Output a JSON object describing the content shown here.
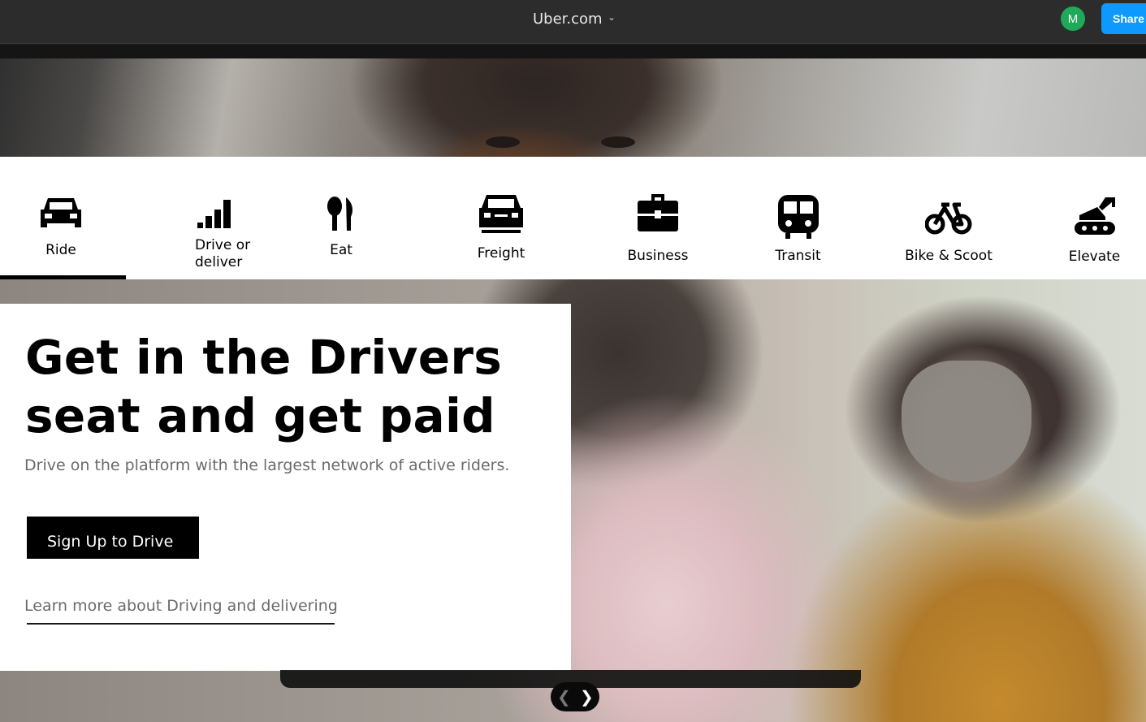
{
  "topbar": {
    "title": "Uber.com",
    "avatar_initial": "M",
    "share_label": "Share"
  },
  "nav": {
    "items": [
      {
        "label": "Ride",
        "icon": "car-icon",
        "selected": true
      },
      {
        "label": "Drive or deliver",
        "line1": "Drive or",
        "line2": "deliver",
        "icon": "signal-bars-icon"
      },
      {
        "label": "Eat",
        "icon": "utensils-icon"
      },
      {
        "label": "Freight",
        "icon": "truck-icon"
      },
      {
        "label": "Business",
        "icon": "briefcase-icon"
      },
      {
        "label": "Transit",
        "icon": "train-icon"
      },
      {
        "label": "Bike & Scoot",
        "icon": "bicycle-icon"
      },
      {
        "label": "Elevate",
        "icon": "aircraft-icon"
      }
    ]
  },
  "hero": {
    "headline_line1": "Get in the Drivers",
    "headline_line2": "seat and get paid",
    "subtext": "Drive on the platform with the largest network of active riders.",
    "cta_label": "Sign Up to Drive",
    "learn_more": "Learn more about Driving and delivering"
  },
  "pager": {
    "prev_icon": "chevron-left-icon",
    "next_icon": "chevron-right-icon"
  },
  "colors": {
    "share_blue": "#0d99ff",
    "avatar_green": "#1faa59",
    "cta_black": "#000000"
  }
}
